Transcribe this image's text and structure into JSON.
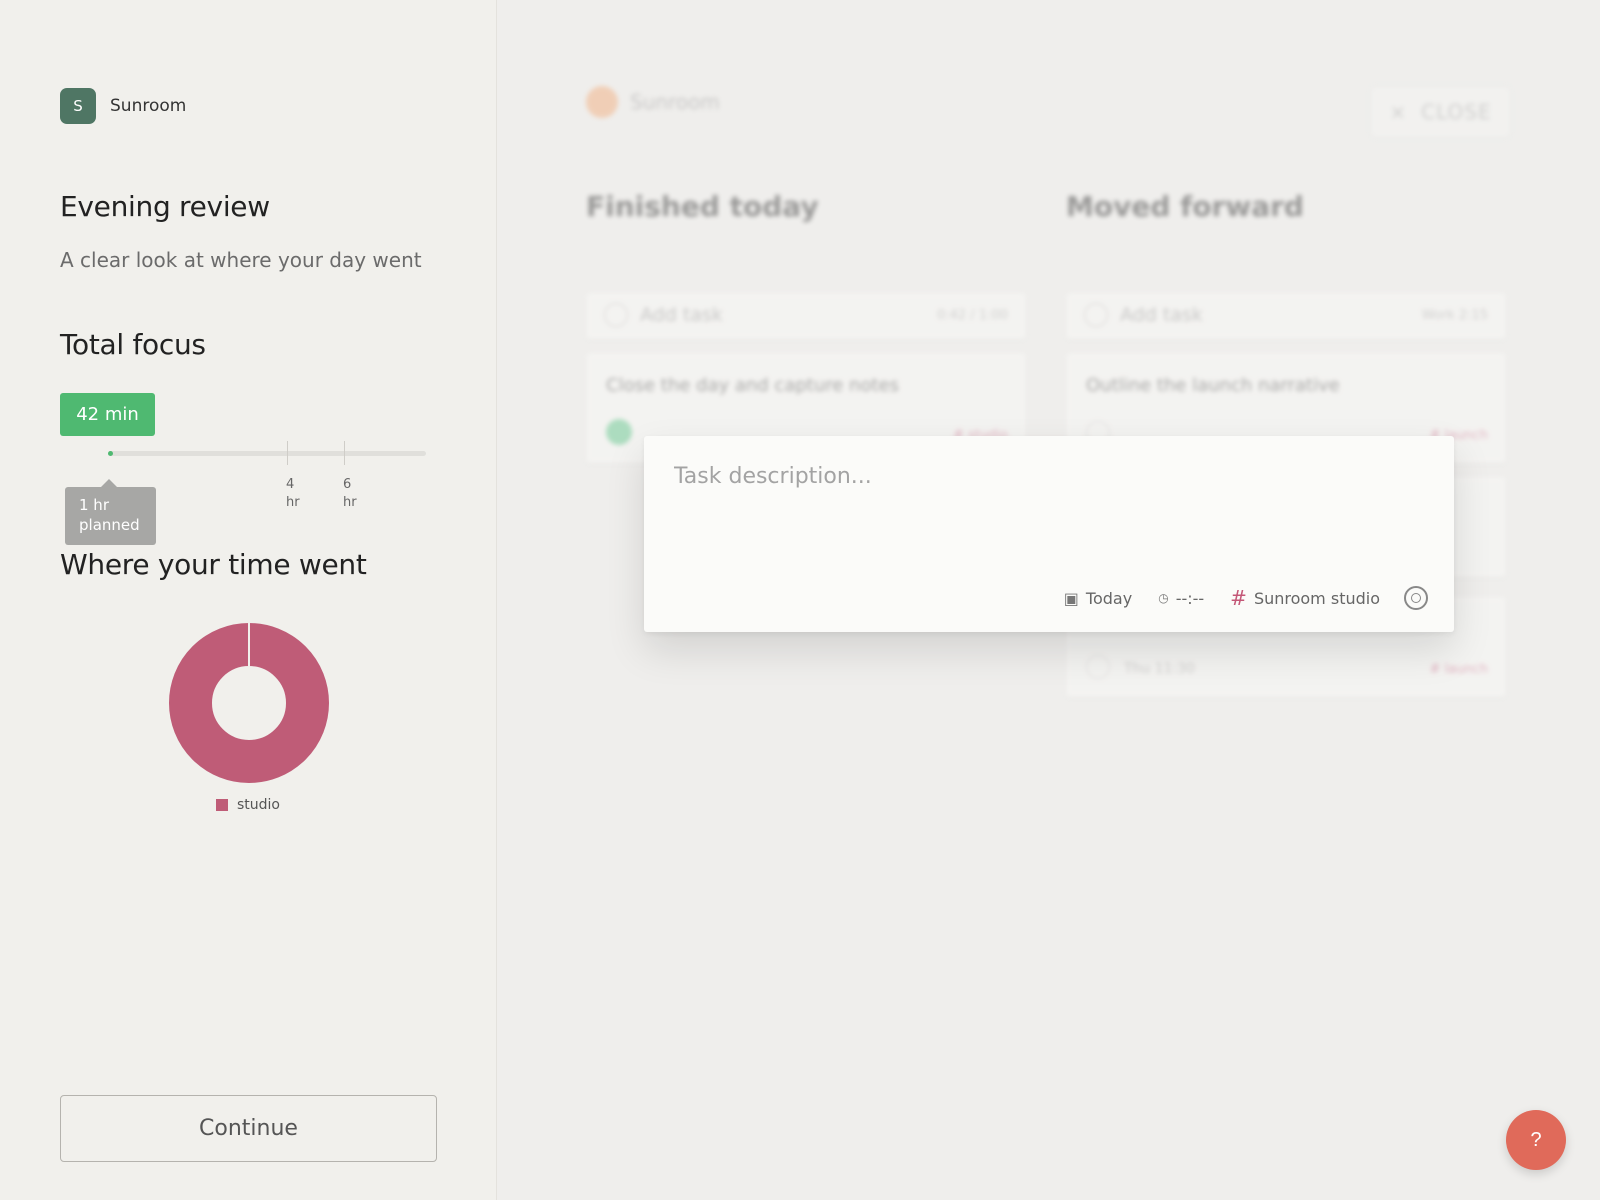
{
  "brand": {
    "initial": "S",
    "name": "Sunroom"
  },
  "review": {
    "title": "Evening review",
    "subtitle": "A clear look at where your day went"
  },
  "focus": {
    "title": "Total focus",
    "badge": "42 min",
    "actual_fraction": 0.0,
    "ticks": [
      {
        "num": "4",
        "unit": "hr"
      },
      {
        "num": "6",
        "unit": "hr"
      }
    ],
    "planned_line1": "1 hr",
    "planned_line2": "planned"
  },
  "time_breakdown": {
    "title": "Where your time went",
    "chart_data": {
      "type": "pie",
      "categories": [
        "studio"
      ],
      "values": [
        100
      ],
      "colors": [
        "#bf5c77"
      ]
    },
    "legend_label": "studio"
  },
  "continue_label": "Continue",
  "board": {
    "logo_name": "Sunroom",
    "close_label": "CLOSE",
    "close_icon": "×",
    "columns": [
      {
        "title": "Finished today",
        "add_label": "Add task",
        "add_meta": "0:42 / 1:00",
        "task_title": "Close the day and capture notes",
        "task_tag": "# studio"
      },
      {
        "title": "Moved forward",
        "add_label": "Add task",
        "add_meta": "Work 2:15",
        "task_title": "Outline the launch narrative",
        "task_tag": "# launch",
        "card3_meta": "Thu 11:30",
        "card3_tag": "# launch"
      }
    ]
  },
  "modal": {
    "placeholder": "Task description...",
    "date_icon": "calendar-icon",
    "date_label": "Today",
    "time_icon": "clock-icon",
    "time_label": "--:--",
    "project_label": "Sunroom studio",
    "hash_glyph": "#"
  },
  "help_label": "?"
}
